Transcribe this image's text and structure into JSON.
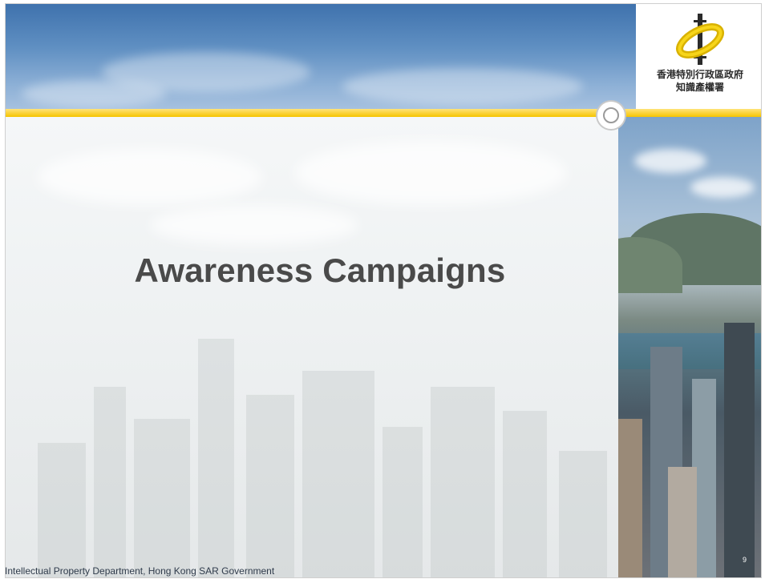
{
  "slide": {
    "title": "Awareness Campaigns",
    "footer": "Intellectual Property Department, Hong Kong SAR Government",
    "page_number": "9"
  },
  "logo": {
    "text_line1": "香港特別行政區政府",
    "text_line2": "知識產權署"
  },
  "colors": {
    "sky_top": "#3f72ad",
    "yellow_band": "#f6c400",
    "title_text": "#4a4a4a",
    "footer_text": "#2f3b4b"
  }
}
